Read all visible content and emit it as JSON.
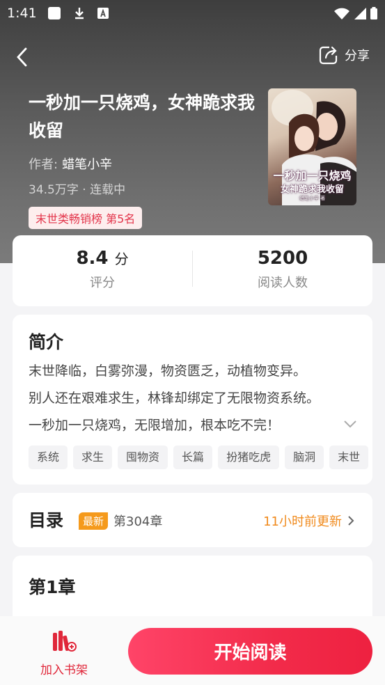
{
  "status": {
    "time": "1:41"
  },
  "header": {
    "share_label": "分享"
  },
  "book": {
    "title": "一秒加一只烧鸡，女神跪求我收留",
    "author_label": "作者:",
    "author_name": "蜡笔小辛",
    "meta": "34.5万字 · 连载中",
    "rank": "末世类畅销榜  第5名",
    "cover_line1": "一秒加一只烧鸡",
    "cover_line2": "女神跪求我收留",
    "cover_author": "蜡笔小辛 著"
  },
  "stats": {
    "score": "8.4",
    "score_unit": "分",
    "score_label": "评分",
    "readers": "5200",
    "readers_label": "阅读人数"
  },
  "intro": {
    "heading": "简介",
    "lines": [
      "末世降临，白雾弥漫，物资匮乏，动植物变异。",
      "别人还在艰难求生，林锋却绑定了无限物资系统。",
      "一秒加一只烧鸡，无限增加，根本吃不完！"
    ],
    "tags": [
      "系统",
      "求生",
      "囤物资",
      "长篇",
      "扮猪吃虎",
      "脑洞",
      "末世"
    ]
  },
  "toc": {
    "heading": "目录",
    "badge": "最新",
    "latest_chapter": "第304章",
    "update": "11小时前更新"
  },
  "chapter": {
    "heading": "第1章"
  },
  "bottom": {
    "shelf_label": "加入书架",
    "read_label": "开始阅读"
  },
  "colors": {
    "accent": "#f22b4a",
    "orange": "#f08a1c"
  }
}
